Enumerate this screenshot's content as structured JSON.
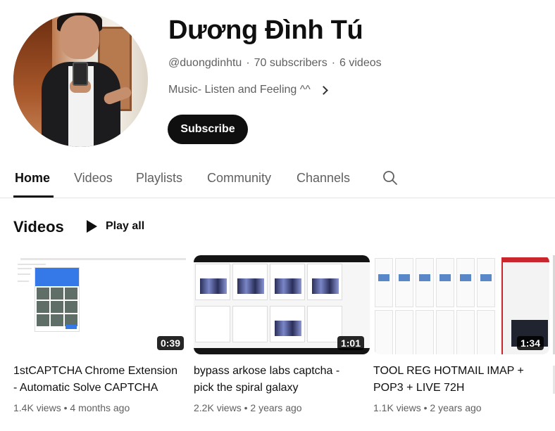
{
  "channel": {
    "name": "Dương Đình Tú",
    "handle": "@duongdinhtu",
    "subscribers": "70 subscribers",
    "videos_count": "6 videos",
    "separator": "·",
    "description": "Music- Listen and Feeling ^^",
    "subscribe_label": "Subscribe"
  },
  "tabs": [
    {
      "label": "Home",
      "active": true
    },
    {
      "label": "Videos",
      "active": false
    },
    {
      "label": "Playlists",
      "active": false
    },
    {
      "label": "Community",
      "active": false
    },
    {
      "label": "Channels",
      "active": false
    }
  ],
  "section": {
    "title": "Videos",
    "play_all_label": "Play all"
  },
  "videos": [
    {
      "title": "1stCAPTCHA Chrome Extension - Automatic Solve CAPTCHA",
      "duration": "0:39",
      "views": "1.4K views",
      "age": "4 months ago"
    },
    {
      "title": "bypass arkose labs captcha - pick the spiral galaxy",
      "duration": "1:01",
      "views": "2.2K views",
      "age": "2 years ago"
    },
    {
      "title": "TOOL REG HOTMAIL IMAP + POP3 + LIVE 72H",
      "duration": "1:34",
      "views": "1.1K views",
      "age": "2 years ago"
    }
  ],
  "stats_separator": "•",
  "icons": {
    "search": "search-icon",
    "play": "play-icon",
    "chevron": "chevron-right-icon"
  },
  "colors": {
    "text_primary": "#0f0f0f",
    "text_secondary": "#606060",
    "subscribe_bg": "#0f0f0f"
  }
}
